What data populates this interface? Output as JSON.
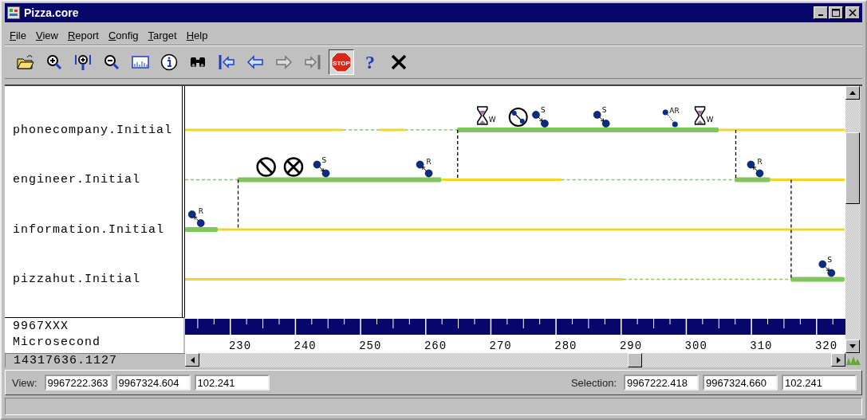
{
  "window": {
    "title": "Pizza.core"
  },
  "menu": [
    "File",
    "View",
    "Report",
    "Config",
    "Target",
    "Help"
  ],
  "toolbar": [
    {
      "kind": "open",
      "disabled": false,
      "pressed": false
    },
    {
      "kind": "zoom-in",
      "disabled": false,
      "pressed": false
    },
    {
      "kind": "zoom-fit",
      "disabled": false,
      "pressed": false
    },
    {
      "kind": "zoom-out",
      "disabled": false,
      "pressed": false
    },
    {
      "kind": "histogram",
      "disabled": false,
      "pressed": false
    },
    {
      "kind": "info",
      "disabled": false,
      "pressed": false
    },
    {
      "kind": "find",
      "disabled": false,
      "pressed": false
    },
    {
      "kind": "go-first",
      "disabled": false,
      "pressed": false
    },
    {
      "kind": "back",
      "disabled": false,
      "pressed": false
    },
    {
      "kind": "forward",
      "disabled": true,
      "pressed": false
    },
    {
      "kind": "go-last",
      "disabled": true,
      "pressed": false
    },
    {
      "kind": "stop",
      "label": "STOP",
      "disabled": false,
      "pressed": true
    },
    {
      "kind": "help",
      "label": "?",
      "disabled": false,
      "pressed": false
    },
    {
      "kind": "close",
      "disabled": false,
      "pressed": false
    }
  ],
  "lanes": [
    {
      "name": "phonecompany.Initial",
      "segments": [
        {
          "kind": "thin"
        },
        {
          "kind": "dashed"
        },
        {
          "kind": "thin"
        },
        {
          "kind": "dashed"
        },
        {
          "kind": "thick"
        },
        {
          "kind": "thin"
        }
      ],
      "events": [
        {
          "kind": "wait",
          "label": "W"
        },
        {
          "kind": "timer"
        },
        {
          "kind": "send",
          "label": "S"
        },
        {
          "kind": "send",
          "label": "S"
        },
        {
          "kind": "async",
          "label": "AR"
        },
        {
          "kind": "wait",
          "label": "W"
        }
      ]
    },
    {
      "name": "engineer.Initial",
      "segments": [
        {
          "kind": "dashed"
        },
        {
          "kind": "thick"
        },
        {
          "kind": "thin"
        },
        {
          "kind": "dashed"
        },
        {
          "kind": "thick"
        },
        {
          "kind": "thin"
        }
      ],
      "events": [
        {
          "kind": "blocked"
        },
        {
          "kind": "cancel"
        },
        {
          "kind": "send",
          "label": "S"
        },
        {
          "kind": "receive",
          "label": "R"
        },
        {
          "kind": "receive",
          "label": "R"
        }
      ]
    },
    {
      "name": "information.Initial",
      "segments": [
        {
          "kind": "thick"
        },
        {
          "kind": "thin"
        }
      ],
      "events": [
        {
          "kind": "receive",
          "label": "R"
        }
      ]
    },
    {
      "name": "pizzahut.Initial",
      "segments": [
        {
          "kind": "thin"
        },
        {
          "kind": "dashed"
        },
        {
          "kind": "thick"
        }
      ],
      "events": [
        {
          "kind": "send",
          "label": "S"
        }
      ]
    }
  ],
  "axis": {
    "base": "9967XXX",
    "unit": "Microsecond",
    "labels": [
      "230",
      "240",
      "250",
      "260",
      "270",
      "280",
      "290",
      "300",
      "310",
      "320"
    ]
  },
  "readout": "14317636.1127",
  "view": {
    "label": "View:",
    "start": "9967222.363",
    "end": "9967324.604",
    "span": "102.241"
  },
  "selection": {
    "label": "Selection:",
    "start": "9967222.418",
    "end": "9967324.660",
    "span": "102.241"
  }
}
